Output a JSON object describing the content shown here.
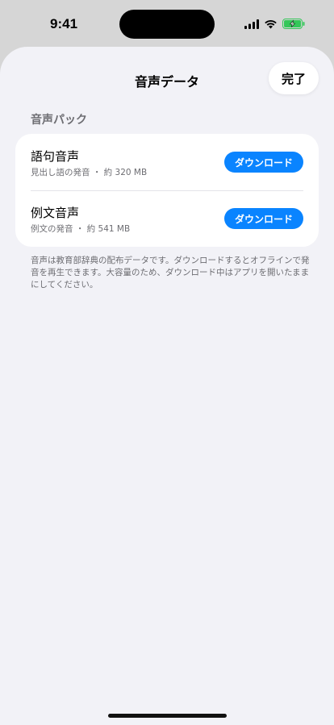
{
  "status_bar": {
    "time": "9:41",
    "icons": [
      "signal-icon",
      "wifi-icon",
      "battery-charging-icon"
    ],
    "battery_color": "#34c759"
  },
  "nav": {
    "title": "音声データ",
    "done_label": "完了"
  },
  "section": {
    "header": "音声パック",
    "items": [
      {
        "title": "語句音声",
        "subtitle": "見出し語の発音 ・ 約 320 MB",
        "button": "ダウンロード"
      },
      {
        "title": "例文音声",
        "subtitle": "例文の発音 ・ 約 541 MB",
        "button": "ダウンロード"
      }
    ],
    "footer": "音声は教育部辞典の配布データです。ダウンロードするとオフラインで発音を再生できます。大容量のため、ダウンロード中はアプリを開いたままにしてください。"
  },
  "colors": {
    "accent": "#0a84ff",
    "background": "#f2f2f7",
    "card": "#ffffff",
    "secondary_text": "#6d6d72"
  }
}
